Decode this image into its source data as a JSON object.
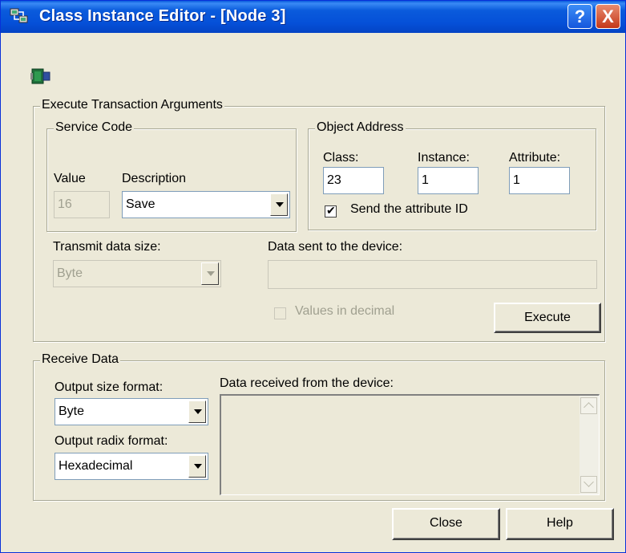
{
  "window": {
    "title": "Class Instance Editor - [Node 3]",
    "help_glyph": "?",
    "close_glyph": "X"
  },
  "execute": {
    "legend": "Execute Transaction Arguments",
    "service_code": {
      "legend": "Service Code",
      "value_label": "Value",
      "value": "16",
      "description_label": "Description",
      "description": "Save"
    },
    "object_address": {
      "legend": "Object Address",
      "class_label": "Class:",
      "class_value": "23",
      "instance_label": "Instance:",
      "instance_value": "1",
      "attribute_label": "Attribute:",
      "attribute_value": "1",
      "send_attr_label": "Send the attribute ID",
      "send_attr_checked": true
    },
    "transmit_label": "Transmit data size:",
    "transmit_value": "Byte",
    "data_sent_label": "Data sent to the device:",
    "data_sent_value": "",
    "values_decimal_label": "Values in decimal",
    "values_decimal_checked": false,
    "execute_button": "Execute"
  },
  "receive": {
    "legend": "Receive Data",
    "output_size_label": "Output size format:",
    "output_size_value": "Byte",
    "output_radix_label": "Output radix format:",
    "output_radix_value": "Hexadecimal",
    "data_received_label": "Data received from the device:",
    "data_received_value": ""
  },
  "buttons": {
    "close": "Close",
    "help": "Help"
  },
  "colors": {
    "title_bar": "#0a5bdc",
    "dialog_bg": "#ece9d8",
    "close_btn": "#c4381a"
  }
}
